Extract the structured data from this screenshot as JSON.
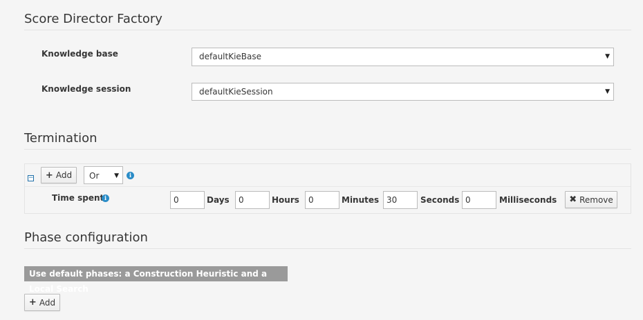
{
  "score_director": {
    "title": "Score Director Factory",
    "knowledge_base_label": "Knowledge base",
    "knowledge_base_value": "defaultKieBase",
    "knowledge_session_label": "Knowledge session",
    "knowledge_session_value": "defaultKieSession"
  },
  "termination": {
    "title": "Termination",
    "add_label": "Add",
    "operator_value": "Or",
    "time_spent_label": "Time spent",
    "days_value": "0",
    "days_label": "Days",
    "hours_value": "0",
    "hours_label": "Hours",
    "minutes_value": "0",
    "minutes_label": "Minutes",
    "seconds_value": "30",
    "seconds_label": "Seconds",
    "milliseconds_value": "0",
    "milliseconds_label": "Milliseconds",
    "remove_label": "Remove"
  },
  "phase": {
    "title": "Phase configuration",
    "default_phases_text": "Use default phases: a Construction Heuristic and a Local Search",
    "add_label": "Add"
  },
  "icons": {
    "plus": "plus-icon",
    "close": "times-icon",
    "info": "info-circle-icon",
    "collapse": "minus-square-icon",
    "caret": "caret-down-icon"
  },
  "colors": {
    "info_icon": "#2a8cc7",
    "badge_bg": "#9a9a9a",
    "page_bg": "#f5f5f5"
  }
}
